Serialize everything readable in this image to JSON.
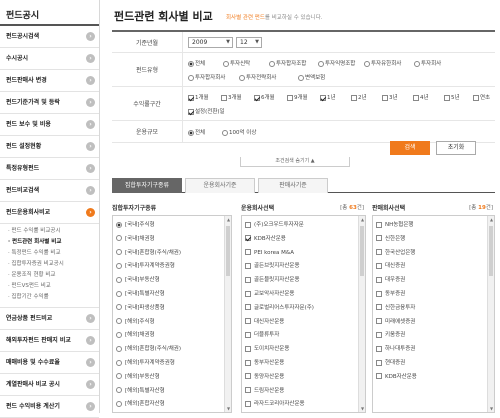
{
  "sidebar": {
    "title": "펀드공시",
    "items": [
      {
        "label": "펀드공시검색"
      },
      {
        "label": "수시공시"
      },
      {
        "label": "펀드판매사 변경"
      },
      {
        "label": "펀드기준가격 및 등락"
      },
      {
        "label": "펀드 보수 및 비용"
      },
      {
        "label": "펀드 설정현황"
      },
      {
        "label": "특정유형펀드"
      },
      {
        "label": "펀드비교검색"
      },
      {
        "label": "펀드운용회사비교"
      }
    ],
    "subitems": [
      "· 펀드 수익률 비교공시",
      "· 펀드관련 회사별 비교",
      "· 특정펀드 수익률 비교",
      "· 집합투자증권 비교공시",
      "· 운용조직 현황 비교",
      "· 펀드VS펀드 비교",
      "· 집합기간 수익률"
    ],
    "items2": [
      {
        "label": "연금상품 펀드비교"
      },
      {
        "label": "해외투자펀드 판매지 비교"
      },
      {
        "label": "매매비용 및 수수료율"
      },
      {
        "label": "계열판매사 비교 공시"
      },
      {
        "label": "펀드 수익비용 계산기"
      }
    ]
  },
  "main": {
    "title": "펀드관련 회사별 비교",
    "desc_hl": "회사별 관련 펀드",
    "desc_rest": "를 비교하실 수 있습니다."
  },
  "form": {
    "base_month_label": "기준년월",
    "year_value": "2009",
    "month_value": "12",
    "fund_type_label": "펀드유형",
    "fund_types_row1": [
      "전체",
      "투자신탁",
      "투자합자조합",
      "투자익명조합",
      "투자유한회사",
      "투자회사"
    ],
    "fund_types_row2": [
      "투자합자회사",
      "투자전략회사",
      "변액보험"
    ],
    "return_period_label": "수익률구간",
    "periods_row1": [
      "1개월",
      "3개월",
      "6개월",
      "9개월",
      "1년",
      "2년",
      "3년",
      "4년",
      "5년",
      "연초"
    ],
    "periods_row2": [
      "설정(전환)일"
    ],
    "size_label": "운용규모",
    "size_options": [
      "전체",
      "100억 이상"
    ],
    "search_button": "검색",
    "reset_button": "초기화",
    "collapse_label": "조건검색 숨기기 ▲"
  },
  "tabs": [
    "집합투자기구종류",
    "운용회사기준",
    "판매사기준"
  ],
  "col1": {
    "title": "집합투자기구종류",
    "items": [
      "[국내]주식형",
      "[국내]채권형",
      "[국내]혼합형(주식/채권)",
      "[국내]투자계약증권형",
      "[국내]부동산형",
      "[국내]특별자산형",
      "[국내]파생상품형",
      "[해외]주식형",
      "[해외]채권형",
      "[해외]혼합형(주식/채권)",
      "[해외]투자계약증권형",
      "[해외]부동산형",
      "[해외]특별자산형",
      "[해외]혼합자산형"
    ]
  },
  "col2": {
    "title": "운용회사선택",
    "count_pre": "[총 ",
    "count": "63",
    "count_post": "건]",
    "items": [
      "(주)오크우드투자자문",
      "KDB자산운용",
      "PEI korea M&A",
      "골든브릿지자산운용",
      "골든블릿지자산운용",
      "교보악사자산운용",
      "글로벌리어스투자자문(주)",
      "대신자산운용",
      "더블류투자",
      "도이치자산운용",
      "동부자산운용",
      "동양자산운용",
      "드림자산운용",
      "라자드코리아자산운용",
      "러시앤캐시자산운용(주)"
    ]
  },
  "col3": {
    "title": "판매회사선택",
    "count_pre": "[총 ",
    "count": "19",
    "count_post": "건]",
    "items": [
      "NH농협은행",
      "신한은행",
      "한국산업은행",
      "대신증권",
      "대우증권",
      "동부증권",
      "신한금융투자",
      "미래에셋증권",
      "키움증권",
      "하나대투증권",
      "현대증권",
      "KDB자산운용"
    ]
  }
}
